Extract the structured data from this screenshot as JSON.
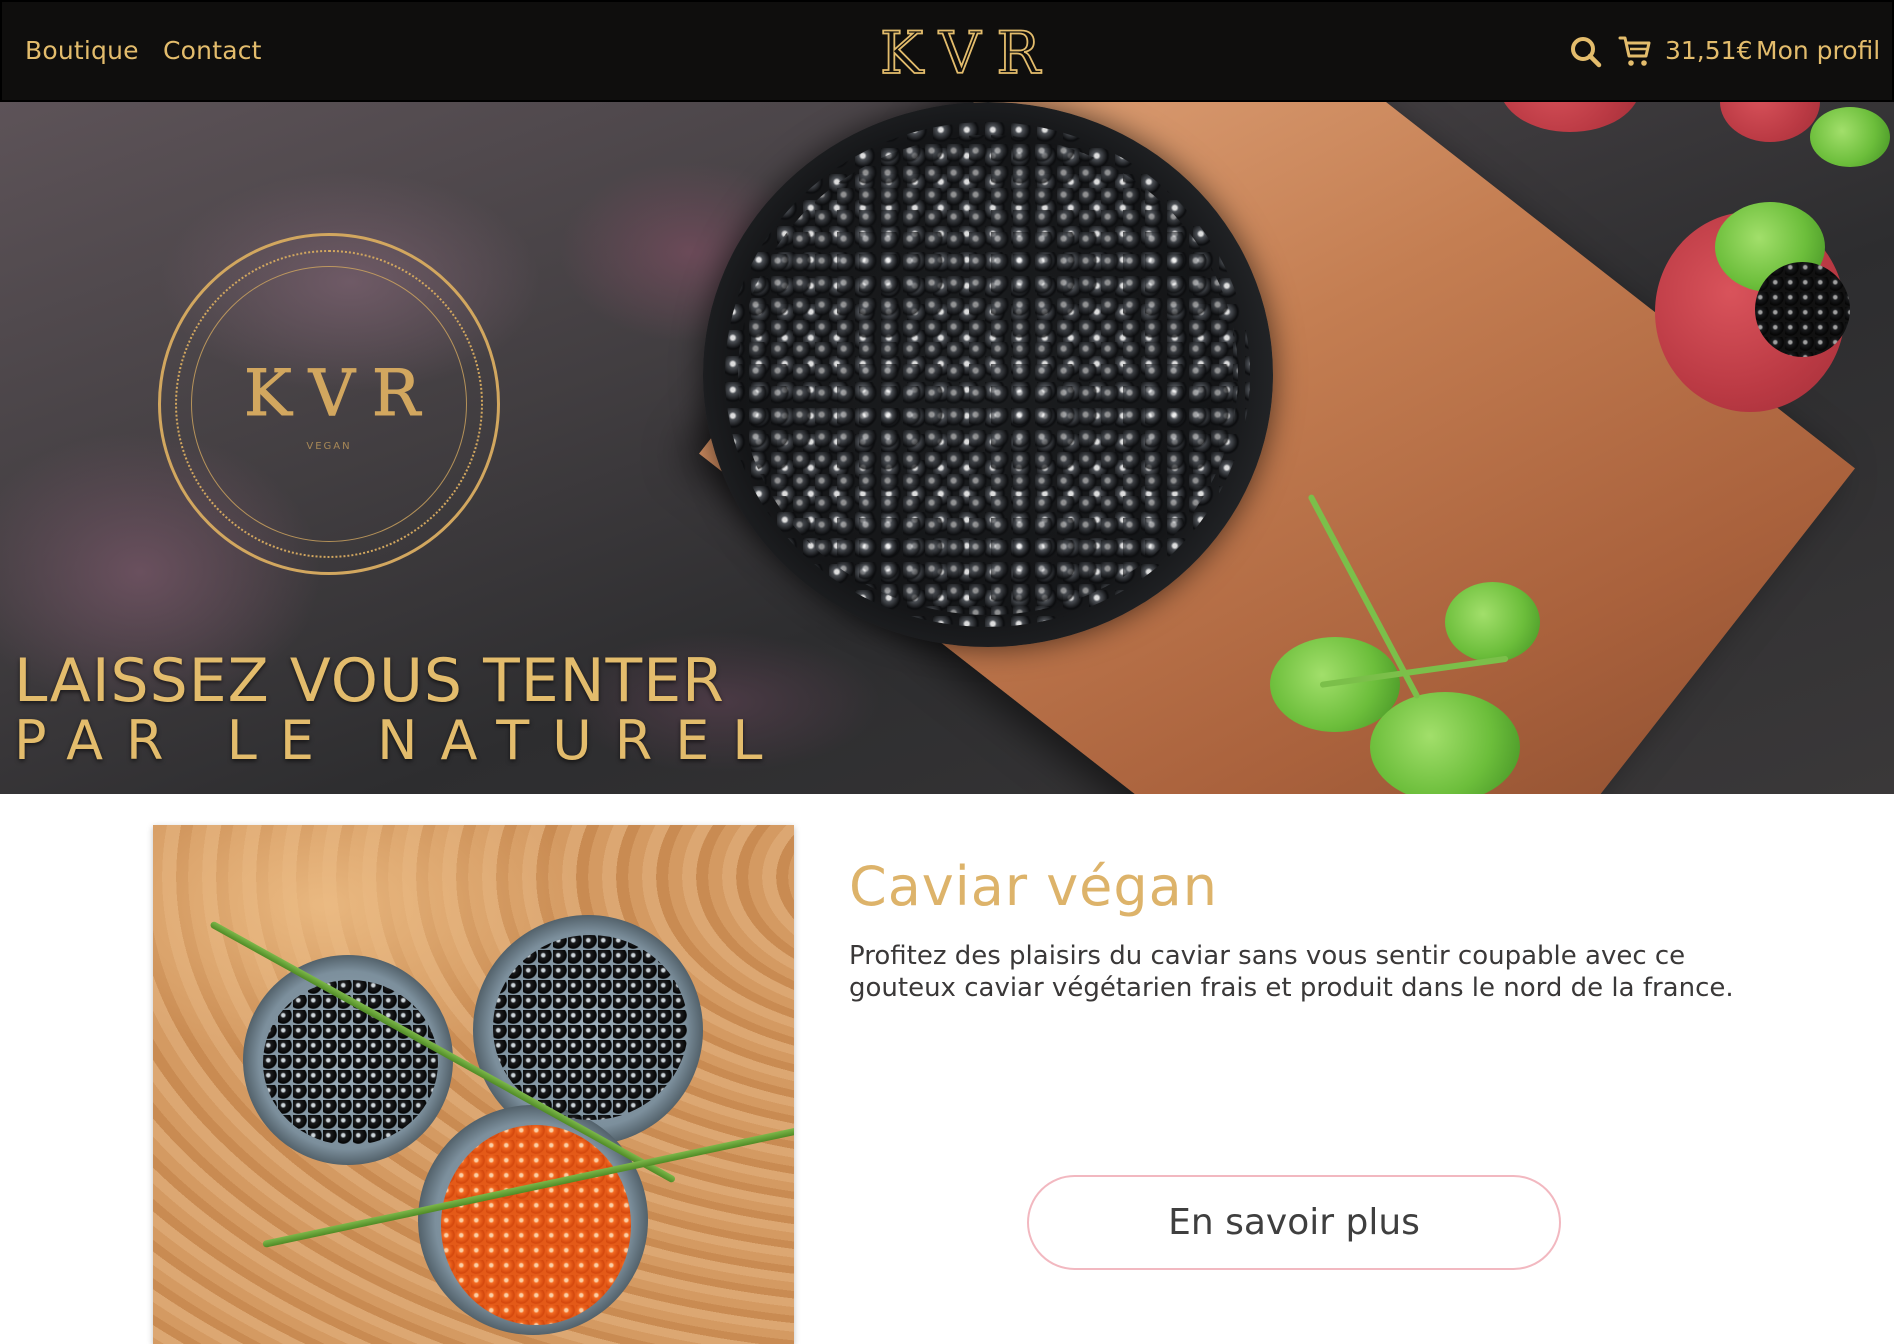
{
  "nav": {
    "links": [
      "Boutique",
      "Contact"
    ],
    "logo_letters": [
      "K",
      "V",
      "R"
    ],
    "cart_total": "31,51€",
    "profile_label": "Mon profil",
    "icons": [
      "search-icon",
      "cart-icon"
    ]
  },
  "hero": {
    "seal_letters": [
      "K",
      "V",
      "R"
    ],
    "seal_subtext": "VEGAN",
    "headline_line1": "LAISSEZ VOUS TENTER",
    "headline_line2": "PAR LE NATUREL"
  },
  "product": {
    "title": "Caviar végan",
    "description": "Profitez des plaisirs du caviar sans vous sentir coupable avec ce gouteux caviar végétarien frais et produit dans le nord de la france.",
    "cta_label": "En savoir plus"
  },
  "colors": {
    "gold": "#e3bc6c",
    "nav_background": "#0f0e0d",
    "button_border": "#f2b8c0"
  }
}
